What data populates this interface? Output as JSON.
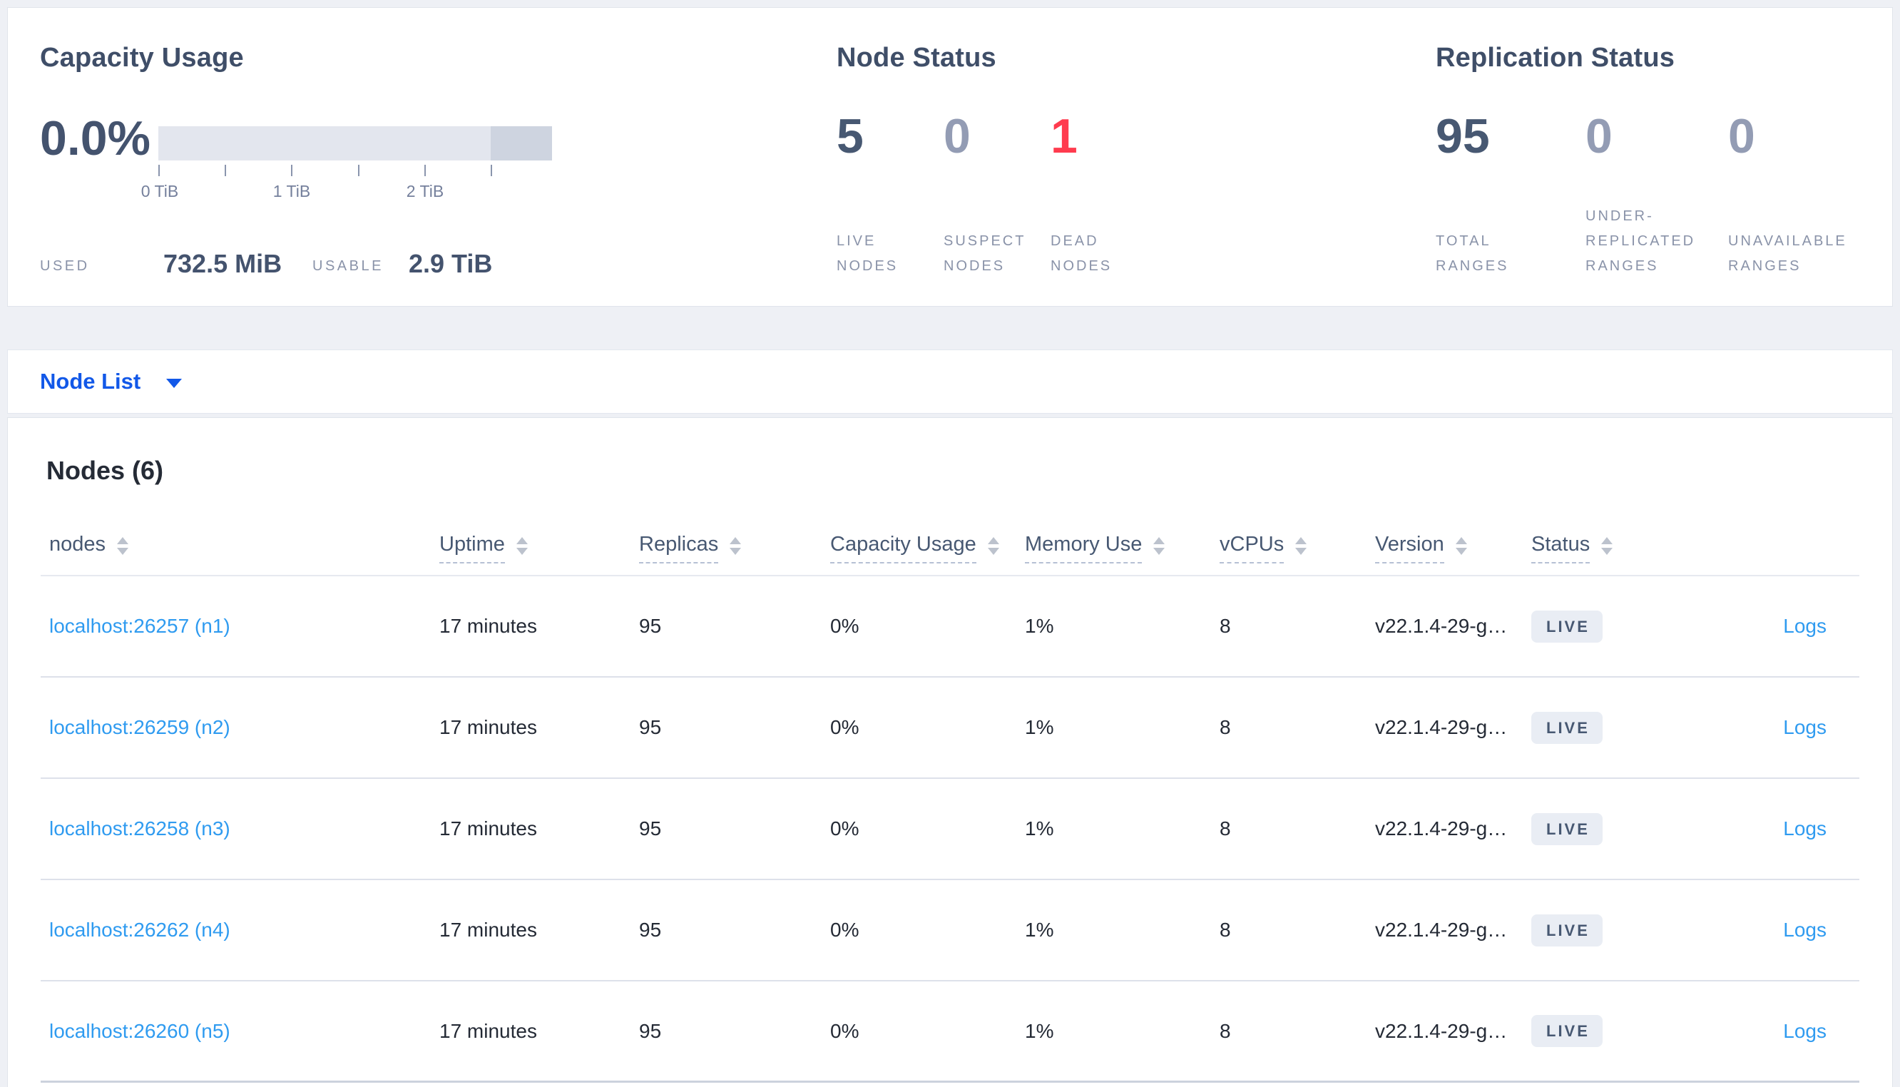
{
  "colors": {
    "accent_blue": "#1258e8",
    "link_blue": "#2f9bf0",
    "dead_red": "#ff3b4e",
    "dark_number": "#475872",
    "muted_number": "#939cb4",
    "badge_bg": "#e9edf4"
  },
  "capacity": {
    "title": "Capacity Usage",
    "percent_used": "0.0%",
    "axis_ticks": [
      "0 TiB",
      "1 TiB",
      "2 TiB"
    ],
    "used_label": "USED",
    "used_value": "732.5 MiB",
    "usable_label": "USABLE",
    "usable_value": "2.9 TiB"
  },
  "node_status": {
    "title": "Node Status",
    "metrics": [
      {
        "name": "live-nodes",
        "value": "5",
        "label": "LIVE NODES",
        "color": "#475872"
      },
      {
        "name": "suspect-nodes",
        "value": "0",
        "label": "SUSPECT NODES",
        "color": "#939cb4"
      },
      {
        "name": "dead-nodes",
        "value": "1",
        "label": "DEAD NODES",
        "color": "#ff3b4e"
      }
    ]
  },
  "replication_status": {
    "title": "Replication Status",
    "metrics": [
      {
        "name": "total-ranges",
        "value": "95",
        "label": "TOTAL RANGES",
        "color": "#475872"
      },
      {
        "name": "under-replicated-ranges",
        "value": "0",
        "label": "UNDER-REPLICATED RANGES",
        "color": "#939cb4"
      },
      {
        "name": "unavailable-ranges",
        "value": "0",
        "label": "UNAVAILABLE RANGES",
        "color": "#939cb4"
      }
    ]
  },
  "view_selector": {
    "label": "Node List"
  },
  "nodes": {
    "title": "Nodes (6)",
    "columns": [
      {
        "label": "nodes",
        "underlined": false
      },
      {
        "label": "Uptime",
        "underlined": true
      },
      {
        "label": "Replicas",
        "underlined": true
      },
      {
        "label": "Capacity Usage",
        "underlined": true
      },
      {
        "label": "Memory Use",
        "underlined": true
      },
      {
        "label": "vCPUs",
        "underlined": true
      },
      {
        "label": "Version",
        "underlined": true
      },
      {
        "label": "Status",
        "underlined": true
      }
    ],
    "rows": [
      {
        "node": "localhost:26257 (n1)",
        "uptime": "17 minutes",
        "replicas": "95",
        "capacity_usage": "0%",
        "memory_use": "1%",
        "vcpus": "8",
        "version": "v22.1.4-29-g…",
        "status": "LIVE",
        "logs_label": "Logs"
      },
      {
        "node": "localhost:26259 (n2)",
        "uptime": "17 minutes",
        "replicas": "95",
        "capacity_usage": "0%",
        "memory_use": "1%",
        "vcpus": "8",
        "version": "v22.1.4-29-g…",
        "status": "LIVE",
        "logs_label": "Logs"
      },
      {
        "node": "localhost:26258 (n3)",
        "uptime": "17 minutes",
        "replicas": "95",
        "capacity_usage": "0%",
        "memory_use": "1%",
        "vcpus": "8",
        "version": "v22.1.4-29-g…",
        "status": "LIVE",
        "logs_label": "Logs"
      },
      {
        "node": "localhost:26262 (n4)",
        "uptime": "17 minutes",
        "replicas": "95",
        "capacity_usage": "0%",
        "memory_use": "1%",
        "vcpus": "8",
        "version": "v22.1.4-29-g…",
        "status": "LIVE",
        "logs_label": "Logs"
      },
      {
        "node": "localhost:26260 (n5)",
        "uptime": "17 minutes",
        "replicas": "95",
        "capacity_usage": "0%",
        "memory_use": "1%",
        "vcpus": "8",
        "version": "v22.1.4-29-g…",
        "status": "LIVE",
        "logs_label": "Logs"
      }
    ]
  }
}
